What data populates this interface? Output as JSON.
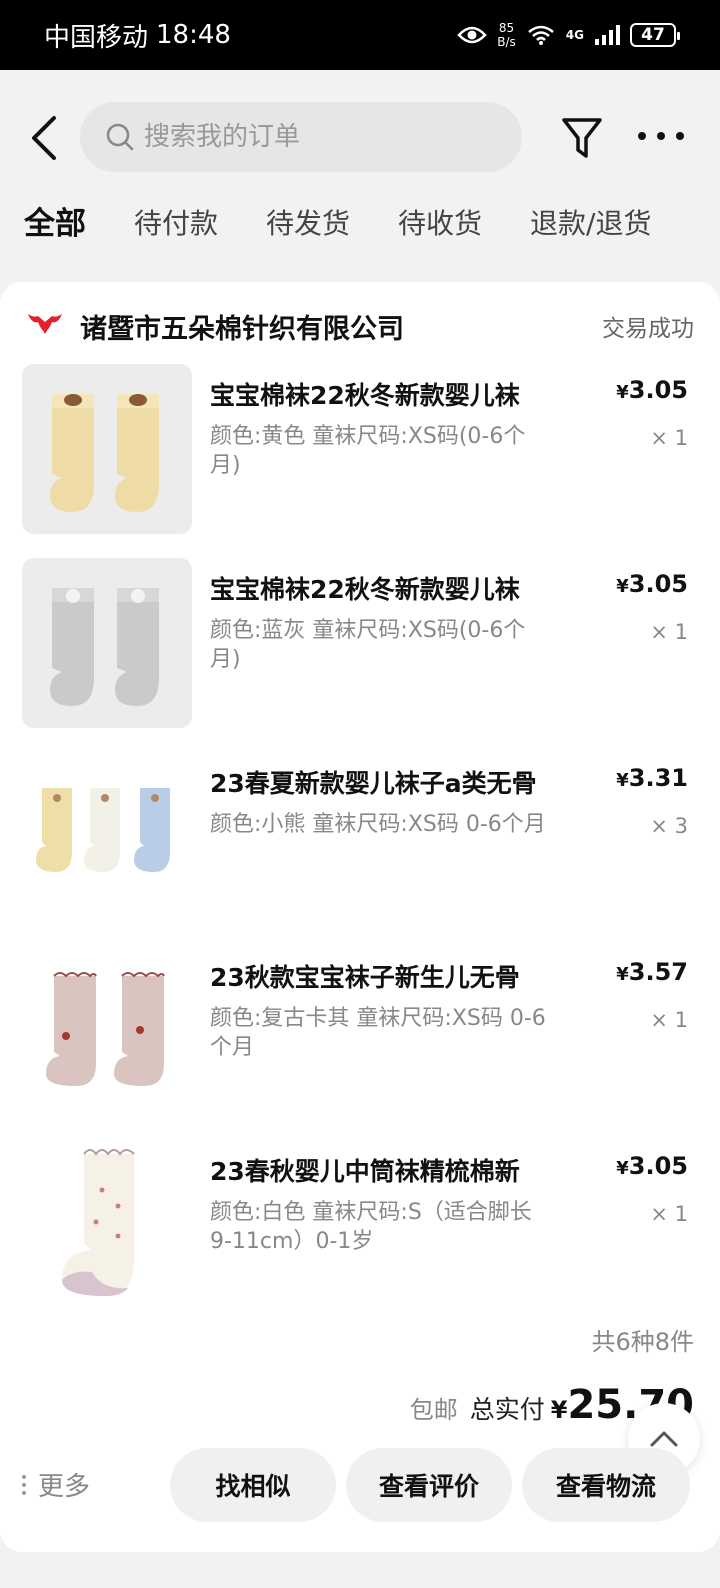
{
  "status_bar": {
    "carrier": "中国移动",
    "time": "18:48",
    "net_speed_value": "85",
    "net_speed_unit": "B/s",
    "network": "4G",
    "battery": "47"
  },
  "header": {
    "search_placeholder": "搜索我的订单"
  },
  "tabs": [
    {
      "label": "全部",
      "active": true
    },
    {
      "label": "待付款",
      "active": false
    },
    {
      "label": "待发货",
      "active": false
    },
    {
      "label": "待收货",
      "active": false
    },
    {
      "label": "退款/退货",
      "active": false
    }
  ],
  "order": {
    "shop_name": "诸暨市五朵棉针织有限公司",
    "status": "交易成功",
    "items": [
      {
        "title": "宝宝棉袜22秋冬新款婴儿袜",
        "spec": "颜色:黄色 童袜尺码:XS码(0-6个月)",
        "price": "3.05",
        "qty": "× 1"
      },
      {
        "title": "宝宝棉袜22秋冬新款婴儿袜",
        "spec": "颜色:蓝灰 童袜尺码:XS码(0-6个月)",
        "price": "3.05",
        "qty": "× 1"
      },
      {
        "title": "23春夏新款婴儿袜子a类无骨",
        "spec": "颜色:小熊 童袜尺码:XS码 0-6个月",
        "price": "3.31",
        "qty": "× 3"
      },
      {
        "title": "23秋款宝宝袜子新生儿无骨",
        "spec": "颜色:复古卡其 童袜尺码:XS码 0-6个月",
        "price": "3.57",
        "qty": "× 1"
      },
      {
        "title": "23春秋婴儿中筒袜精梳棉新",
        "spec": "颜色:白色 童袜尺码:S（适合脚长9-11cm）0-1岁",
        "price": "3.05",
        "qty": "× 1"
      }
    ],
    "currency": "¥",
    "count_summary": "共6种8件",
    "free_shipping": "包邮",
    "total_label": "总实付",
    "total_value": "25.70"
  },
  "actions": {
    "more": "更多",
    "find_similar": "找相似",
    "view_reviews": "查看评价",
    "view_logistics": "查看物流"
  }
}
